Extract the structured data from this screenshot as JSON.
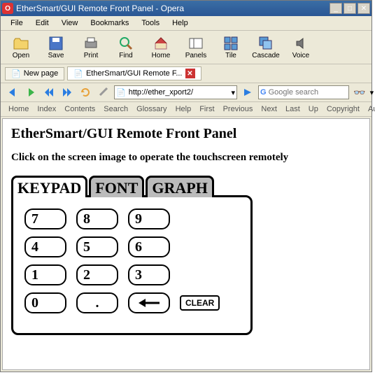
{
  "window": {
    "title": "EtherSmart/GUI Remote Front Panel - Opera"
  },
  "menubar": [
    "File",
    "Edit",
    "View",
    "Bookmarks",
    "Tools",
    "Help"
  ],
  "toolbar": [
    {
      "id": "open",
      "label": "Open"
    },
    {
      "id": "save",
      "label": "Save"
    },
    {
      "id": "print",
      "label": "Print"
    },
    {
      "id": "find",
      "label": "Find"
    },
    {
      "id": "home",
      "label": "Home"
    },
    {
      "id": "panels",
      "label": "Panels"
    },
    {
      "id": "tile",
      "label": "Tile"
    },
    {
      "id": "cascade",
      "label": "Cascade"
    },
    {
      "id": "voice",
      "label": "Voice"
    }
  ],
  "tabs": {
    "new": "New page",
    "active": "EtherSmart/GUI Remote F..."
  },
  "nav": {
    "url": "http://ether_xport2/",
    "search_placeholder": "Google search"
  },
  "linkbar": [
    "Home",
    "Index",
    "Contents",
    "Search",
    "Glossary",
    "Help",
    "First",
    "Previous",
    "Next",
    "Last",
    "Up",
    "Copyright",
    "Author"
  ],
  "page": {
    "heading": "EtherSmart/GUI Remote Front Panel",
    "instruction": "Click on the screen image to operate the touchscreen remotely",
    "tabs": [
      "KEYPAD",
      "FONT",
      "GRAPH"
    ],
    "active_tab": "KEYPAD",
    "keypad": {
      "rows": [
        [
          "7",
          "8",
          "9"
        ],
        [
          "4",
          "5",
          "6"
        ],
        [
          "1",
          "2",
          "3"
        ]
      ],
      "bottom": {
        "zero": "0",
        "dot": ".",
        "back": "←",
        "clear": "CLEAR"
      }
    }
  }
}
